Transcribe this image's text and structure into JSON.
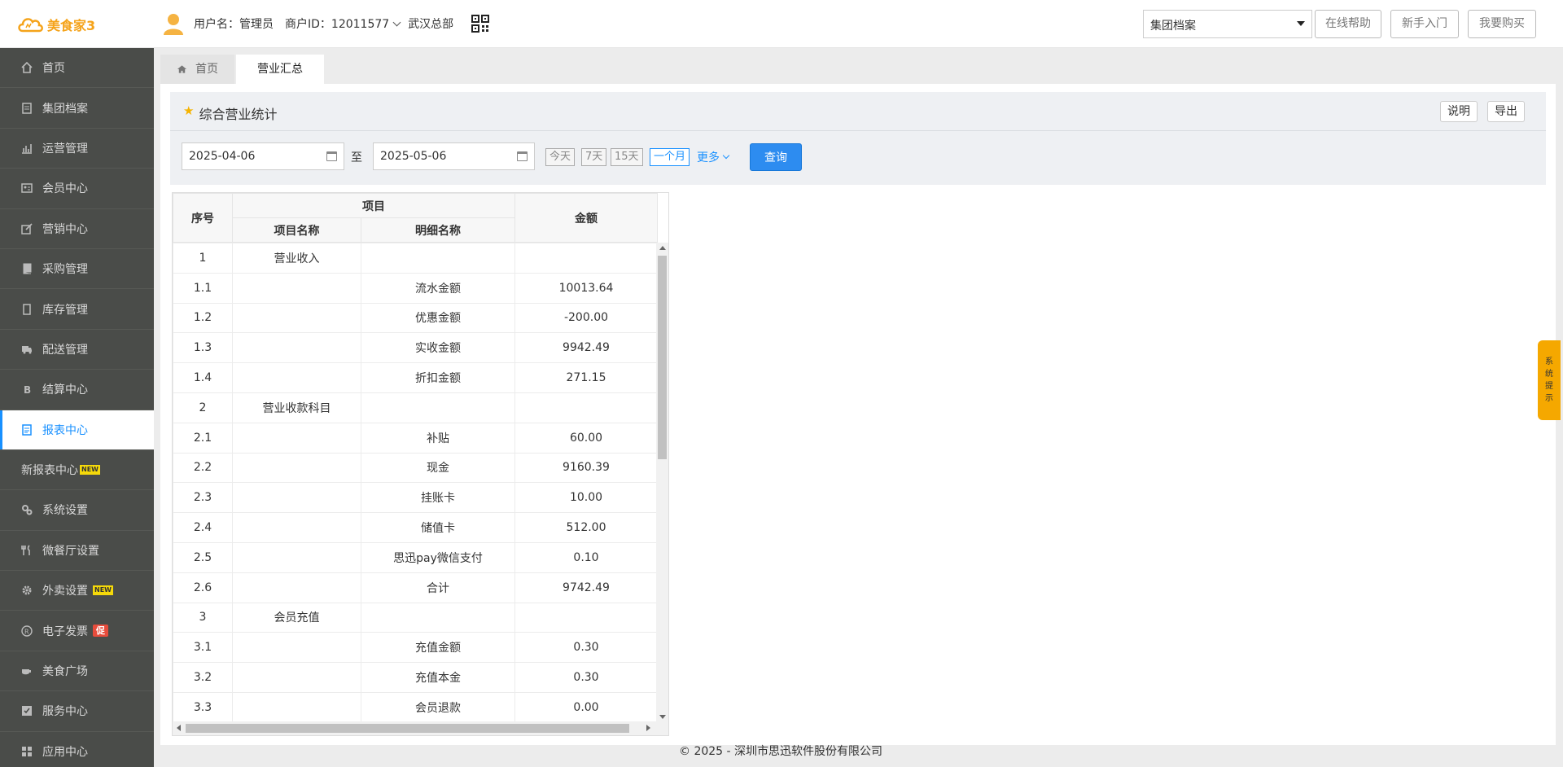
{
  "app": {
    "logo_text": "美食家3",
    "user_label": "用户名：管理员",
    "merchant_label": "商户ID：12011577",
    "store": "武汉总部"
  },
  "top_right": {
    "select_value": "集团档案",
    "buttons": [
      "在线帮助",
      "新手入门",
      "我要购买"
    ]
  },
  "sidebar": {
    "items": [
      {
        "label": "首页",
        "icon": "home-icon"
      },
      {
        "label": "集团档案",
        "icon": "document-icon"
      },
      {
        "label": "运营管理",
        "icon": "bar-chart-icon"
      },
      {
        "label": "会员中心",
        "icon": "id-card-icon"
      },
      {
        "label": "营销中心",
        "icon": "edit-icon"
      },
      {
        "label": "采购管理",
        "icon": "book-icon"
      },
      {
        "label": "库存管理",
        "icon": "tablet-icon"
      },
      {
        "label": "配送管理",
        "icon": "truck-icon"
      },
      {
        "label": "结算中心",
        "icon": "bitcoin-icon"
      },
      {
        "label": "报表中心",
        "icon": "report-icon"
      },
      {
        "label": "新报表中心",
        "badge": "NEW"
      },
      {
        "label": "系统设置",
        "icon": "gears-icon"
      },
      {
        "label": "微餐厅设置",
        "icon": "cutlery-icon"
      },
      {
        "label": "外卖设置",
        "icon": "gear-icon",
        "badge": "NEW"
      },
      {
        "label": "电子发票",
        "icon": "registered-icon",
        "badge": "促"
      },
      {
        "label": "美食广场",
        "icon": "coffee-icon"
      },
      {
        "label": "服务中心",
        "icon": "check-square-icon"
      },
      {
        "label": "应用中心",
        "icon": "grid-icon"
      }
    ]
  },
  "tabs": [
    {
      "label": "首页",
      "icon": "home-icon"
    },
    {
      "label": "营业汇总"
    }
  ],
  "panel": {
    "title": "综合营业统计",
    "buttons": [
      "说明",
      "导出"
    ]
  },
  "filter": {
    "start_date": "2025-04-06",
    "to_label": "至",
    "end_date": "2025-05-06",
    "quick": [
      "今天",
      "7天",
      "15天",
      "一个月"
    ],
    "selected_quick": "一个月",
    "more_label": "更多",
    "query_label": "查询"
  },
  "table": {
    "headers": {
      "index": "序号",
      "project": "项目",
      "project_name": "项目名称",
      "detail_name": "明细名称",
      "amount": "金额"
    },
    "rows": [
      {
        "index": "1",
        "name": "营业收入",
        "detail": "",
        "amount": ""
      },
      {
        "index": "1.1",
        "name": "",
        "detail": "流水金额",
        "amount": "10013.64"
      },
      {
        "index": "1.2",
        "name": "",
        "detail": "优惠金额",
        "amount": "-200.00"
      },
      {
        "index": "1.3",
        "name": "",
        "detail": "实收金额",
        "amount": "9942.49"
      },
      {
        "index": "1.4",
        "name": "",
        "detail": "折扣金额",
        "amount": "271.15"
      },
      {
        "index": "2",
        "name": "营业收款科目",
        "detail": "",
        "amount": ""
      },
      {
        "index": "2.1",
        "name": "",
        "detail": "补贴",
        "amount": "60.00"
      },
      {
        "index": "2.2",
        "name": "",
        "detail": "现金",
        "amount": "9160.39"
      },
      {
        "index": "2.3",
        "name": "",
        "detail": "挂账卡",
        "amount": "10.00"
      },
      {
        "index": "2.4",
        "name": "",
        "detail": "储值卡",
        "amount": "512.00"
      },
      {
        "index": "2.5",
        "name": "",
        "detail": "思迅pay微信支付",
        "amount": "0.10"
      },
      {
        "index": "2.6",
        "name": "",
        "detail": "合计",
        "amount": "9742.49"
      },
      {
        "index": "3",
        "name": "会员充值",
        "detail": "",
        "amount": ""
      },
      {
        "index": "3.1",
        "name": "",
        "detail": "充值金额",
        "amount": "0.30"
      },
      {
        "index": "3.2",
        "name": "",
        "detail": "充值本金",
        "amount": "0.30"
      },
      {
        "index": "3.3",
        "name": "",
        "detail": "会员退款",
        "amount": "0.00"
      }
    ]
  },
  "footer": "© 2025 - 深圳市思迅软件股份有限公司",
  "side_tip": [
    "系",
    "统",
    "提",
    "示"
  ],
  "colors": {
    "accent": "#1890ff",
    "query_button": "#2d8cf0",
    "sidebar_bg": "#4a4c49",
    "logo": "#f5a31a",
    "tip": "#f5a800"
  }
}
